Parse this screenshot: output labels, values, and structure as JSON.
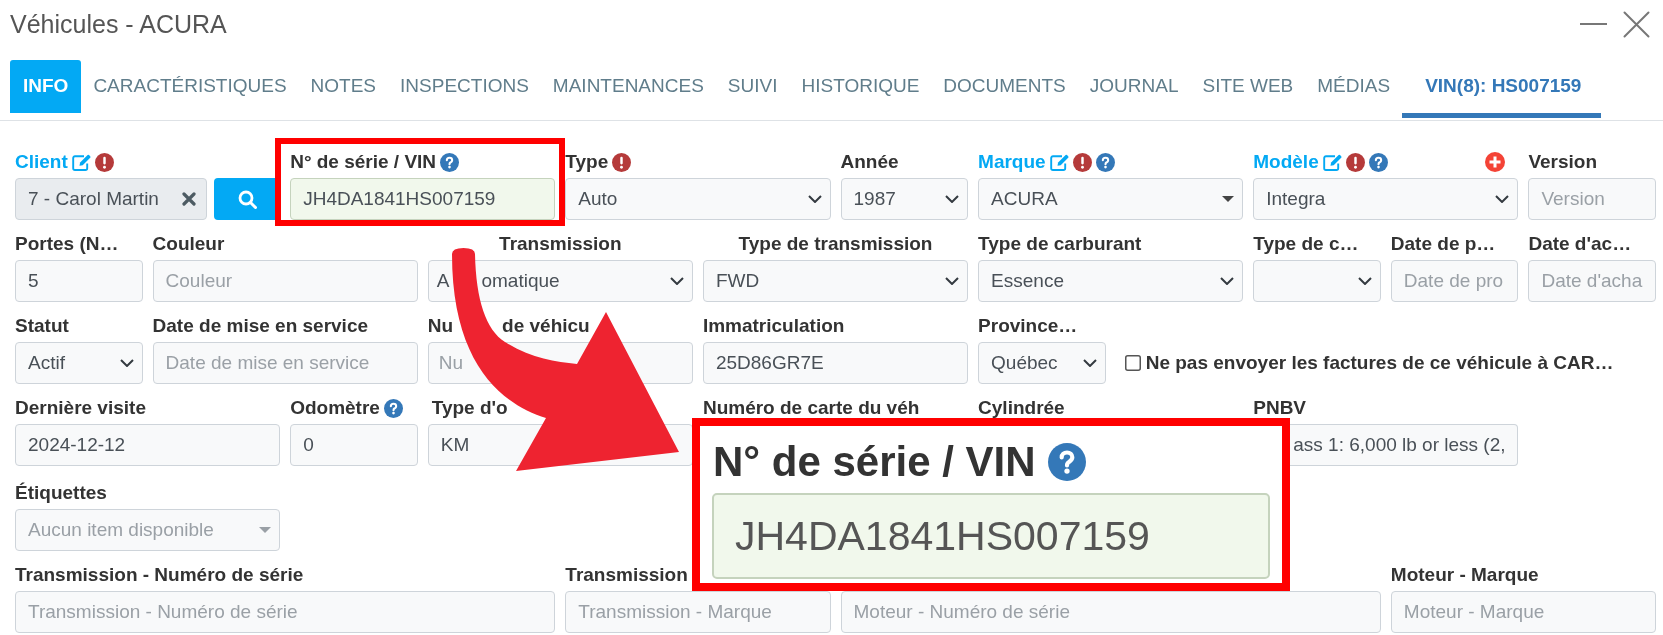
{
  "window": {
    "title": "Véhicules - ACURA"
  },
  "tabs": [
    {
      "label": "INFO",
      "kind": "page",
      "selected": true
    },
    {
      "label": "CARACTÉRISTIQUES",
      "kind": "page",
      "selected": false
    },
    {
      "label": "NOTES",
      "kind": "page",
      "selected": false
    },
    {
      "label": "INSPECTIONS",
      "kind": "page",
      "selected": false
    },
    {
      "label": "MAINTENANCES",
      "kind": "page",
      "selected": false
    },
    {
      "label": "SUIVI",
      "kind": "page",
      "selected": false
    },
    {
      "label": "HISTORIQUE",
      "kind": "page",
      "selected": false
    },
    {
      "label": "DOCUMENTS",
      "kind": "page",
      "selected": false
    },
    {
      "label": "JOURNAL",
      "kind": "page",
      "selected": false
    },
    {
      "label": "SITE WEB",
      "kind": "page",
      "selected": false
    },
    {
      "label": "MÉDIAS",
      "kind": "page",
      "selected": false
    },
    {
      "label": "VIN(8): HS007159",
      "kind": "vin",
      "selected": false
    }
  ],
  "form": {
    "rows": [
      {
        "fields": [
          {
            "kind": "lookup",
            "label": "Client",
            "link": true,
            "edit": true,
            "required": true,
            "help": false,
            "add": false,
            "value": "7 - Carol Martin"
          },
          {
            "kind": "input",
            "label": "N° de série / VIN",
            "link": false,
            "edit": false,
            "required": false,
            "help": true,
            "add": false,
            "valid": true,
            "value": "JH4DA1841HS007159"
          },
          {
            "kind": "select",
            "label": "Type",
            "link": false,
            "edit": false,
            "required": true,
            "help": false,
            "add": false,
            "value": "Auto"
          },
          {
            "kind": "select",
            "label": "Année",
            "link": false,
            "edit": false,
            "required": false,
            "help": false,
            "add": false,
            "value": "1987"
          },
          {
            "kind": "combo",
            "label": "Marque",
            "link": true,
            "edit": true,
            "required": true,
            "help": true,
            "add": false,
            "disabled": false,
            "value": "ACURA"
          },
          {
            "kind": "select",
            "label": "Modèle",
            "link": true,
            "edit": true,
            "required": true,
            "help": true,
            "add": true,
            "value": "Integra"
          },
          {
            "kind": "input",
            "label": "Version",
            "link": false,
            "edit": false,
            "required": false,
            "help": false,
            "add": false,
            "valid": false,
            "placeholder": "Version"
          }
        ]
      },
      {
        "fields": [
          {
            "kind": "input",
            "label": "Portes (N…",
            "link": false,
            "edit": false,
            "required": false,
            "help": false,
            "add": false,
            "valid": false,
            "value": "5"
          },
          {
            "kind": "input",
            "label": "Couleur",
            "link": false,
            "edit": false,
            "required": false,
            "help": false,
            "add": false,
            "valid": false,
            "placeholder": "Couleur"
          },
          {
            "kind": "select",
            "label": "Transmission",
            "link": false,
            "edit": false,
            "required": false,
            "help": false,
            "add": false,
            "value_parts": [
              "A",
              "omatique"
            ]
          },
          {
            "kind": "select",
            "label": "Type de transmission",
            "link": false,
            "edit": false,
            "required": false,
            "help": false,
            "add": false,
            "value": "FWD"
          },
          {
            "kind": "select",
            "label": "Type de carburant",
            "link": false,
            "edit": false,
            "required": false,
            "help": false,
            "add": false,
            "value": "Essence"
          },
          {
            "kind": "select",
            "label": "Type de c…",
            "link": false,
            "edit": false,
            "required": false,
            "help": false,
            "add": false
          },
          {
            "kind": "input",
            "label": "Date de p…",
            "link": false,
            "edit": false,
            "required": false,
            "help": false,
            "add": false,
            "valid": false,
            "placeholder": "Date de pro"
          },
          {
            "kind": "input",
            "label": "Date d'ac…",
            "link": false,
            "edit": false,
            "required": false,
            "help": false,
            "add": false,
            "valid": false,
            "placeholder": "Date d'acha"
          }
        ]
      },
      {
        "fields": [
          {
            "kind": "select",
            "label": "Statut",
            "link": false,
            "edit": false,
            "required": false,
            "help": false,
            "add": false,
            "value": "Actif"
          },
          {
            "kind": "input",
            "label": "Date de mise en service",
            "link": false,
            "edit": false,
            "required": false,
            "help": false,
            "add": false,
            "valid": false,
            "placeholder": "Date de mise en service"
          },
          {
            "kind": "input",
            "label_parts": [
              "Nu",
              "de véhicu"
            ],
            "link": false,
            "edit": false,
            "required": false,
            "help": false,
            "add": false,
            "valid": false,
            "placeholder": "Nu"
          },
          {
            "kind": "input",
            "label": "Immatriculation",
            "link": false,
            "edit": false,
            "required": false,
            "help": false,
            "add": false,
            "valid": false,
            "value": "25D86GR7E"
          },
          {
            "kind": "select",
            "label": "Province…",
            "link": false,
            "edit": false,
            "required": false,
            "help": false,
            "add": false,
            "value": "Québec"
          },
          {
            "kind": "checkbox",
            "text": "Ne pas envoyer les factures de ce véhicule à CAR…",
            "checked": false
          }
        ]
      },
      {
        "fields": [
          {
            "kind": "input",
            "label": "Dernière visite",
            "link": false,
            "edit": false,
            "required": false,
            "help": false,
            "add": false,
            "valid": false,
            "value": "2024-12-12"
          },
          {
            "kind": "input",
            "label": "Odomètre",
            "link": false,
            "edit": false,
            "required": false,
            "help": true,
            "add": false,
            "valid": false,
            "value": "0"
          },
          {
            "kind": "select",
            "label": "Type d'o",
            "link": false,
            "edit": false,
            "required": false,
            "help": false,
            "add": false,
            "value": "KM"
          },
          {
            "kind": "label",
            "label": "Numéro de carte du véh",
            "link": false,
            "edit": false,
            "required": false,
            "help": false,
            "add": false
          },
          {
            "kind": "label",
            "label": "Cylindrée",
            "link": false,
            "edit": false,
            "required": false,
            "help": false,
            "add": false
          },
          {
            "kind": "select",
            "label": "PNBV",
            "link": false,
            "edit": false,
            "required": false,
            "help": false,
            "add": false,
            "value": "ass 1: 6,000 lb or less (2,"
          }
        ]
      },
      {
        "fields": [
          {
            "kind": "combo",
            "label": "Étiquettes",
            "link": false,
            "edit": false,
            "required": false,
            "help": false,
            "add": false,
            "disabled": true,
            "placeholder": "Aucun item disponible"
          }
        ]
      },
      {
        "fields": [
          {
            "kind": "input",
            "label": "Transmission - Numéro de série",
            "link": false,
            "edit": false,
            "required": false,
            "help": false,
            "add": false,
            "valid": false,
            "placeholder": "Transmission - Numéro de série"
          },
          {
            "kind": "input",
            "label": "Transmission",
            "link": false,
            "edit": false,
            "required": false,
            "help": false,
            "add": false,
            "valid": false,
            "placeholder": "Transmission - Marque"
          },
          {
            "kind": "input",
            "valid": false,
            "placeholder": "Moteur - Numéro de série"
          },
          {
            "kind": "input",
            "label": "Moteur - Marque",
            "link": false,
            "edit": false,
            "required": false,
            "help": false,
            "add": false,
            "valid": false,
            "placeholder": "Moteur - Marque"
          }
        ]
      }
    ]
  },
  "callout": {
    "label": "N° de série / VIN",
    "help": true,
    "valid": true,
    "value": "JH4DA1841HS007159"
  }
}
